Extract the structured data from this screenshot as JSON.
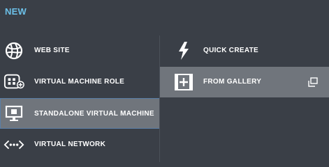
{
  "header": {
    "title": "NEW"
  },
  "left_menu": {
    "items": [
      {
        "label": "WEB SITE",
        "icon": "web-site-icon"
      },
      {
        "label": "VIRTUAL MACHINE ROLE",
        "icon": "vm-role-icon"
      },
      {
        "label": "STANDALONE VIRTUAL MACHINE",
        "icon": "monitor-icon",
        "selected": true
      },
      {
        "label": "VIRTUAL NETWORK",
        "icon": "network-icon"
      }
    ]
  },
  "right_menu": {
    "items": [
      {
        "label": "QUICK CREATE",
        "icon": "lightning-icon"
      },
      {
        "label": "FROM GALLERY",
        "icon": "gallery-icon",
        "selected": true,
        "trailing_icon": "open-window-icon"
      }
    ]
  },
  "colors": {
    "background": "#3a3f47",
    "accent": "#6cc0e8",
    "selected": "#70757c",
    "selected_border": "#5a7fa8"
  }
}
